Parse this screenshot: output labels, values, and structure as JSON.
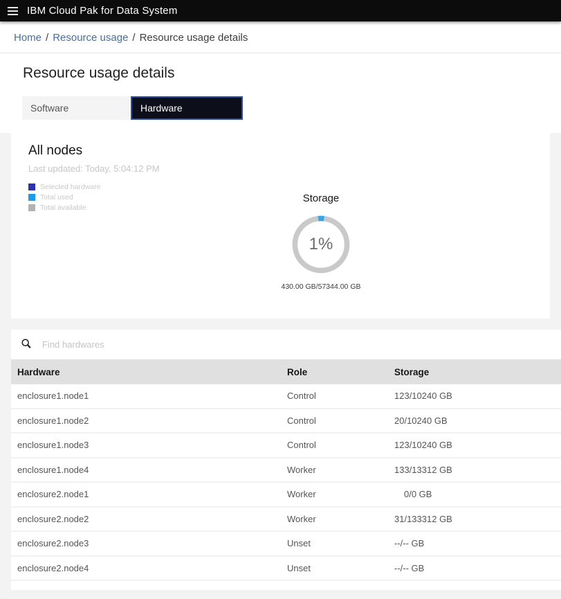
{
  "app_bar": {
    "title": "IBM Cloud Pak for Data System"
  },
  "breadcrumb": {
    "items": [
      {
        "label": "Home"
      },
      {
        "label": "Resource usage"
      },
      {
        "label": "Resource usage details"
      }
    ],
    "separator": "/"
  },
  "page": {
    "title": "Resource usage details"
  },
  "tabs": [
    {
      "label": "Software",
      "selected": false
    },
    {
      "label": "Hardware",
      "selected": true
    }
  ],
  "card": {
    "title": "All nodes",
    "last_updated": "Last updated: Today, 5:04:12 PM",
    "legend": [
      {
        "label": "Selected hardware",
        "color": "#2b32b3"
      },
      {
        "label": "Total used",
        "color": "#1a9ce8"
      },
      {
        "label": "Total available",
        "color": "#b5b1ae"
      }
    ]
  },
  "chart_data": {
    "type": "donut",
    "title": "Storage",
    "percent": 1,
    "percent_label": "1%",
    "used_gb": 430.0,
    "total_gb": 57344.0,
    "caption": "430.00 GB/57344.00 GB",
    "track_color": "#c9c9c9",
    "segment_color": "#3aa5e0"
  },
  "search": {
    "placeholder": "Find hardwares"
  },
  "table": {
    "columns": [
      "Hardware",
      "Role",
      "Storage"
    ],
    "rows": [
      {
        "hardware": "enclosure1.node1",
        "role": "Control",
        "storage": "123/10240 GB"
      },
      {
        "hardware": "enclosure1.node2",
        "role": "Control",
        "storage": "20/10240 GB"
      },
      {
        "hardware": "enclosure1.node3",
        "role": "Control",
        "storage": "123/10240 GB"
      },
      {
        "hardware": "enclosure1.node4",
        "role": "Worker",
        "storage": "133/13312 GB"
      },
      {
        "hardware": "enclosure2.node1",
        "role": "Worker",
        "storage": "0/0 GB"
      },
      {
        "hardware": "enclosure2.node2",
        "role": "Worker",
        "storage": "31/133312 GB"
      },
      {
        "hardware": "enclosure2.node3",
        "role": "Unset",
        "storage": "--/-- GB"
      },
      {
        "hardware": "enclosure2.node4",
        "role": "Unset",
        "storage": "--/-- GB"
      }
    ]
  }
}
